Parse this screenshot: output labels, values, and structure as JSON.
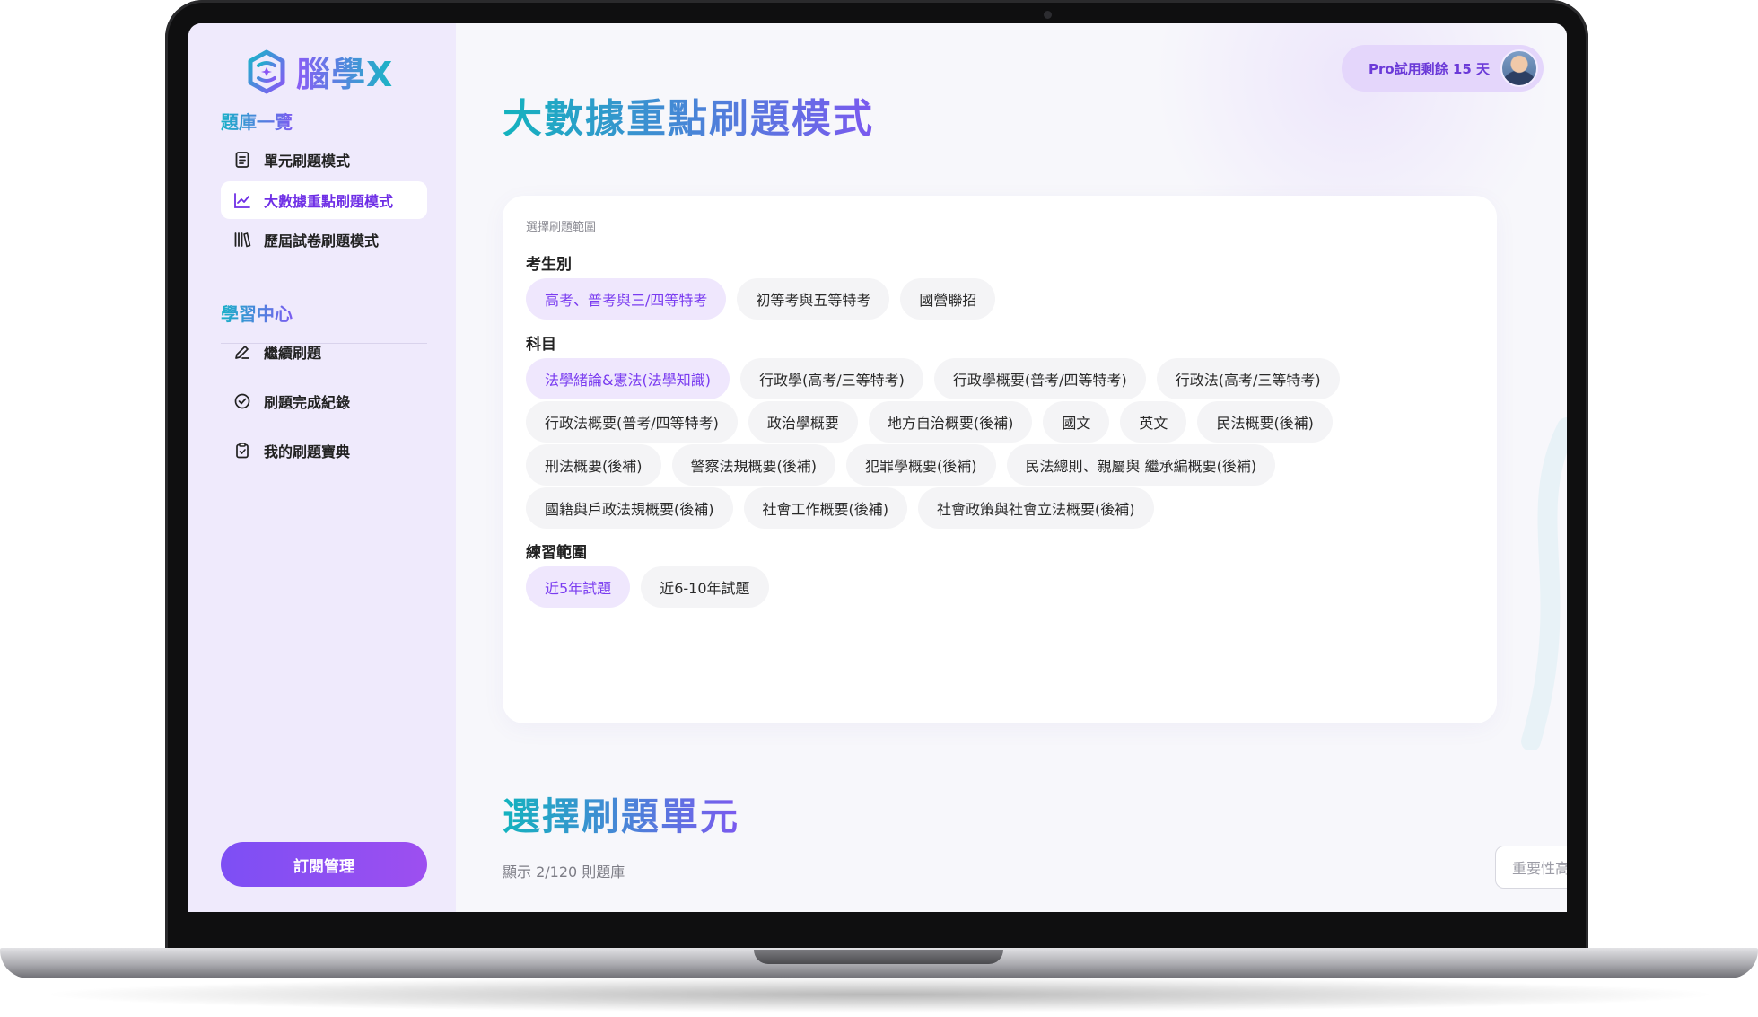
{
  "brand": {
    "name": "腦學X",
    "accent": "#7b4ff3",
    "teal": "#17b1c7"
  },
  "sidebar": {
    "sections": [
      {
        "title": "題庫一覽",
        "items": [
          {
            "label": "單元刷題模式",
            "icon": "document-icon",
            "active": false
          },
          {
            "label": "大數據重點刷題模式",
            "icon": "trend-chart-icon",
            "active": true
          },
          {
            "label": "歷屆試卷刷題模式",
            "icon": "books-icon",
            "active": false
          }
        ]
      },
      {
        "title": "學習中心",
        "items": [
          {
            "label": "繼續刷題",
            "icon": "pencil-icon",
            "active": false
          },
          {
            "label": "刷題完成紀錄",
            "icon": "check-circle-icon",
            "active": false
          },
          {
            "label": "我的刷題寶典",
            "icon": "clipboard-icon",
            "active": false
          }
        ]
      }
    ],
    "subscribe_label": "訂閱管理"
  },
  "header": {
    "pro_badge": "Pro試用剩餘 15 天"
  },
  "main": {
    "title": "大數據重點刷題模式",
    "card_caption": "選擇刷題範圍",
    "exam_type": {
      "label": "考生別",
      "options": [
        "高考、普考與三/四等特考",
        "初等考與五等特考",
        "國營聯招"
      ],
      "selected": 0
    },
    "subject": {
      "label": "科目",
      "rows": [
        [
          "法學緒論&憲法(法學知識)",
          "行政學(高考/三等特考)",
          "行政學概要(普考/四等特考)",
          "行政法(高考/三等特考)"
        ],
        [
          "行政法概要(普考/四等特考)",
          "政治學概要",
          "地方自治概要(後補)",
          "國文",
          "英文",
          "民法概要(後補)"
        ],
        [
          "刑法概要(後補)",
          "警察法規概要(後補)",
          "犯罪學概要(後補)",
          "民法總則、親屬與 繼承編概要(後補)"
        ],
        [
          "國籍與戶政法規概要(後補)",
          "社會工作概要(後補)",
          "社會政策與社會立法概要(後補)"
        ]
      ],
      "selected": "法學緒論&憲法(法學知識)"
    },
    "range": {
      "label": "練習範圍",
      "options": [
        "近5年試題",
        "近6-10年試題"
      ],
      "selected": 0
    },
    "units_title": "選擇刷題單元",
    "count_text": "顯示 2/120 則題庫",
    "sort": {
      "value": "重要性高到低"
    }
  }
}
